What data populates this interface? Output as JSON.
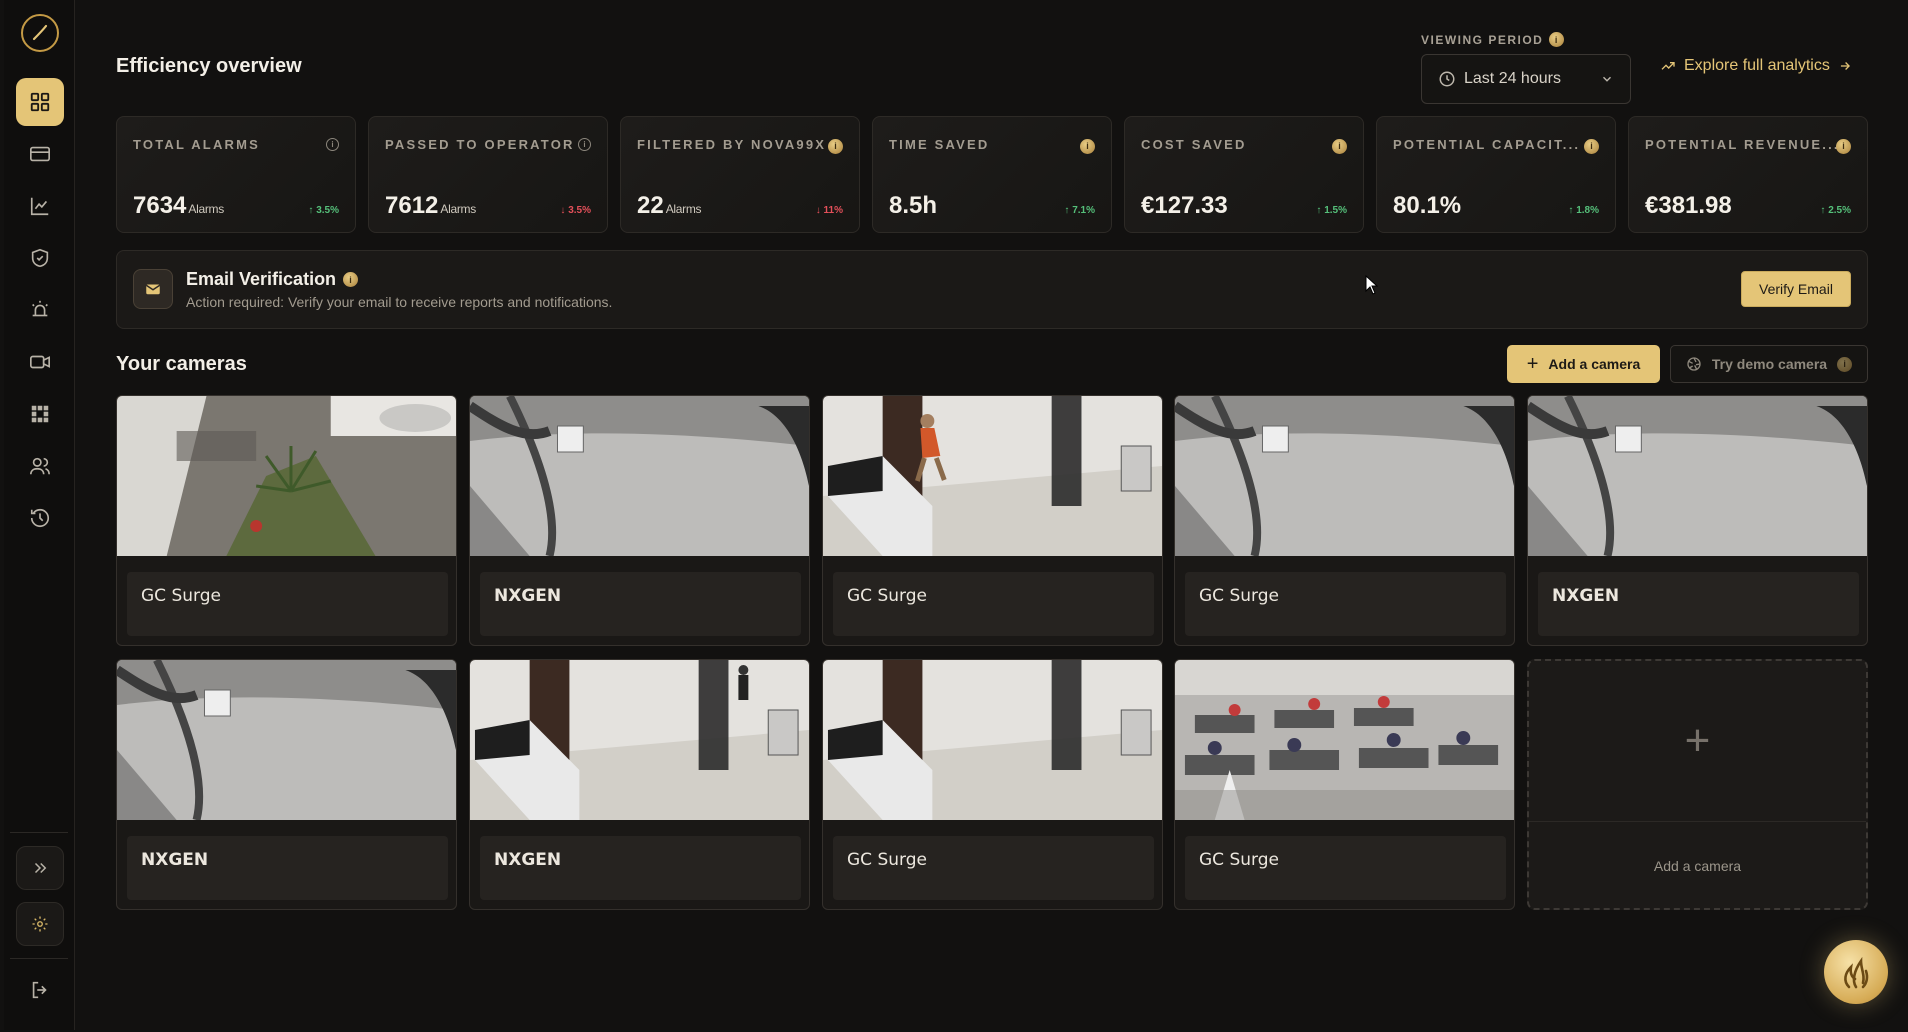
{
  "header": {
    "title": "Efficiency overview",
    "viewing_period_label": "VIEWING PERIOD",
    "viewing_period_value": "Last 24 hours",
    "explore_label": "Explore full analytics"
  },
  "stats": [
    {
      "label": "TOTAL ALARMS",
      "value": "7634",
      "unit": "Alarms",
      "delta": "3.5%",
      "direction": "up"
    },
    {
      "label": "PASSED TO OPERATOR",
      "value": "7612",
      "unit": "Alarms",
      "delta": "3.5%",
      "direction": "down"
    },
    {
      "label": "FILTERED BY NOVA99X",
      "value": "22",
      "unit": "Alarms",
      "delta": "11%",
      "direction": "down"
    },
    {
      "label": "TIME SAVED",
      "value": "8.5h",
      "unit": "",
      "delta": "7.1%",
      "direction": "up"
    },
    {
      "label": "COST SAVED",
      "value": "€127.33",
      "unit": "",
      "delta": "1.5%",
      "direction": "up"
    },
    {
      "label": "POTENTIAL CAPACIT...",
      "value": "80.1%",
      "unit": "",
      "delta": "1.8%",
      "direction": "up"
    },
    {
      "label": "POTENTIAL REVENUE...",
      "value": "€381.98",
      "unit": "",
      "delta": "2.5%",
      "direction": "up"
    }
  ],
  "banner": {
    "title": "Email Verification",
    "text": "Action required: Verify your email to receive reports and notifications.",
    "button": "Verify Email"
  },
  "cameras_section": {
    "title": "Your cameras",
    "add_button": "Add a camera",
    "demo_button": "Try demo camera",
    "add_tile_label": "Add a camera"
  },
  "cameras": [
    {
      "name": "GC Surge",
      "scene": "outdoor"
    },
    {
      "name": "NXGEN",
      "scene": "gray"
    },
    {
      "name": "GC Surge",
      "scene": "hall-person"
    },
    {
      "name": "GC Surge",
      "scene": "gray"
    },
    {
      "name": "NXGEN",
      "scene": "gray"
    },
    {
      "name": "NXGEN",
      "scene": "gray"
    },
    {
      "name": "NXGEN",
      "scene": "hall"
    },
    {
      "name": "GC Surge",
      "scene": "hall"
    },
    {
      "name": "GC Surge",
      "scene": "office"
    }
  ],
  "colors": {
    "accent": "#e4c577",
    "background": "#121110",
    "up": "#55c07a",
    "down": "#e4505a"
  },
  "sidebar_icons": [
    "dashboard-icon",
    "card-icon",
    "chart-icon",
    "shield-icon",
    "alarm-icon",
    "camera-icon",
    "grid-icon",
    "users-icon",
    "history-icon"
  ]
}
